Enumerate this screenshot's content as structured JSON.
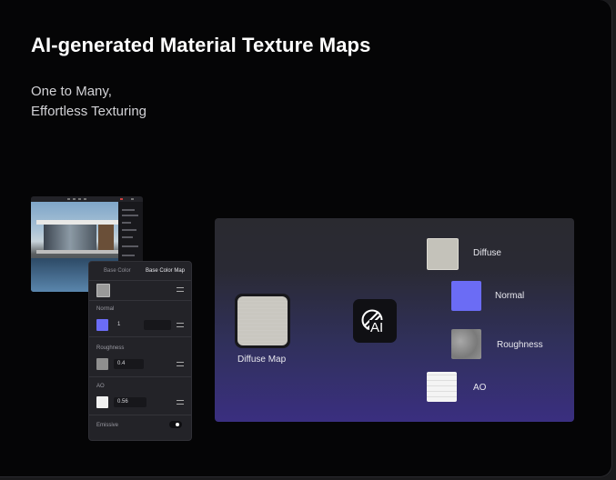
{
  "header": {
    "title": "AI-generated Material Texture Maps",
    "subtitle_line1": "One to Many,",
    "subtitle_line2": "Effortless Texturing"
  },
  "material_panel": {
    "tab_base_color": "Base Color",
    "tab_base_color_map": "Base Color Map",
    "normal_label": "Normal",
    "normal_value": "1",
    "roughness_label": "Roughness",
    "roughness_value": "0.4",
    "ao_label": "AO",
    "ao_value": "0.56",
    "emissive_label": "Emissive"
  },
  "generator": {
    "input_label": "Diffuse Map",
    "ai_logo_text": "AI",
    "outputs": [
      {
        "label": "Diffuse"
      },
      {
        "label": "Normal"
      },
      {
        "label": "Roughness"
      },
      {
        "label": "AO"
      }
    ]
  },
  "colors": {
    "normal_swatch": "#6b6cf5",
    "diffuse_swatch": "#c4c2ba",
    "roughness_swatch": "#8f8f8f",
    "ao_swatch": "#f1f1f1",
    "box_gradient_bottom": "#3a2f80"
  }
}
